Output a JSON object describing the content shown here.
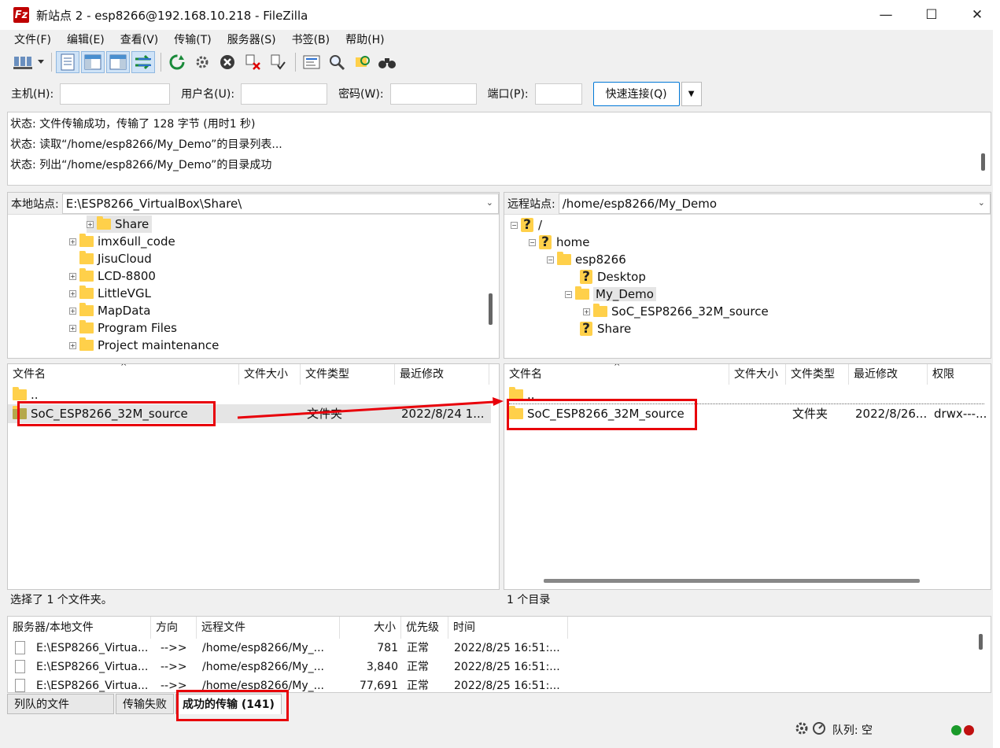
{
  "window": {
    "title": "新站点 2 - esp8266@192.168.10.218 - FileZilla",
    "app_icon": "Fz",
    "minimize": "—",
    "maximize": "☐",
    "close": "✕"
  },
  "menu": [
    "文件(F)",
    "编辑(E)",
    "查看(V)",
    "传输(T)",
    "服务器(S)",
    "书签(B)",
    "帮助(H)"
  ],
  "toolbar_icons": [
    "site-manager-icon",
    "message-log-toggle-icon",
    "local-tree-toggle-icon",
    "remote-tree-toggle-icon",
    "transfer-queue-toggle-icon",
    "refresh-icon",
    "process-queue-icon",
    "cancel-icon",
    "disconnect-icon",
    "reconnect-icon",
    "directory-filter-icon",
    "search-icon",
    "sync-browse-icon",
    "compare-icon"
  ],
  "quickconnect": {
    "host_label": "主机(H):",
    "user_label": "用户名(U):",
    "pass_label": "密码(W):",
    "port_label": "端口(P):",
    "host": "",
    "user": "",
    "pass": "",
    "port": "",
    "connect_button": "快速连接(Q)",
    "dropdown": "▼"
  },
  "log": [
    "状态:  文件传输成功，传输了 128 字节 (用时1 秒)",
    "状态:  读取“/home/esp8266/My_Demo”的目录列表...",
    "状态:  列出“/home/esp8266/My_Demo”的目录成功"
  ],
  "local": {
    "label": "本地站点:",
    "path": "E:\\ESP8266_VirtualBox\\Share\\",
    "tree": [
      {
        "name": "Share",
        "expander": "+",
        "selected": true
      },
      {
        "name": "imx6ull_code",
        "expander": "+"
      },
      {
        "name": "JisuCloud",
        "expander": ""
      },
      {
        "name": "LCD-8800",
        "expander": "+"
      },
      {
        "name": "LittleVGL",
        "expander": "+"
      },
      {
        "name": "MapData",
        "expander": "+"
      },
      {
        "name": "Program Files",
        "expander": "+"
      },
      {
        "name": "Project maintenance",
        "expander": "+"
      }
    ],
    "columns": [
      "文件名",
      "文件大小",
      "文件类型",
      "最近修改"
    ],
    "sort_indicator": "^",
    "files": [
      {
        "name": "..",
        "size": "",
        "type": "",
        "modified": ""
      },
      {
        "name": "SoC_ESP8266_32M_source",
        "size": "",
        "type": "文件夹",
        "modified": "2022/8/24 1..."
      }
    ],
    "status": "选择了 1 个文件夹。"
  },
  "remote": {
    "label": "远程站点:",
    "path": "/home/esp8266/My_Demo",
    "tree": [
      {
        "name": "/",
        "expander": "−",
        "icon": "question"
      },
      {
        "name": "home",
        "expander": "−",
        "icon": "question"
      },
      {
        "name": "esp8266",
        "expander": "−",
        "icon": "folder"
      },
      {
        "name": "Desktop",
        "expander": "",
        "icon": "question"
      },
      {
        "name": "My_Demo",
        "expander": "−",
        "icon": "folder",
        "selected": true
      },
      {
        "name": "SoC_ESP8266_32M_source",
        "expander": "+",
        "icon": "folder"
      },
      {
        "name": "Share",
        "expander": "",
        "icon": "question"
      }
    ],
    "columns": [
      "文件名",
      "文件大小",
      "文件类型",
      "最近修改",
      "权限"
    ],
    "sort_indicator": "^",
    "files": [
      {
        "name": "..",
        "size": "",
        "type": "",
        "modified": "",
        "perm": ""
      },
      {
        "name": "SoC_ESP8266_32M_source",
        "size": "",
        "type": "文件夹",
        "modified": "2022/8/26...",
        "perm": "drwx---..."
      }
    ],
    "status": "1 个目录"
  },
  "queue": {
    "columns": [
      "服务器/本地文件",
      "方向",
      "远程文件",
      "大小",
      "优先级",
      "时间"
    ],
    "rows": [
      {
        "local": "E:\\ESP8266_Virtua...",
        "dir": "-->>",
        "remote": "/home/esp8266/My_...",
        "size": "781",
        "priority": "正常",
        "time": "2022/8/25 16:51:..."
      },
      {
        "local": "E:\\ESP8266_Virtua...",
        "dir": "-->>",
        "remote": "/home/esp8266/My_...",
        "size": "3,840",
        "priority": "正常",
        "time": "2022/8/25 16:51:..."
      },
      {
        "local": "E:\\ESP8266_Virtua...",
        "dir": "-->>",
        "remote": "/home/esp8266/My_...",
        "size": "77,691",
        "priority": "正常",
        "time": "2022/8/25 16:51:..."
      }
    ]
  },
  "tabs": [
    "列队的文件",
    "传输失败",
    "成功的传输 (141)"
  ],
  "bottom": {
    "queue_text": "队列: 空"
  },
  "colors": {
    "annotation_red": "#e8000a",
    "folder_yellow": "#ffd04a",
    "accent_blue": "#0078d7"
  }
}
